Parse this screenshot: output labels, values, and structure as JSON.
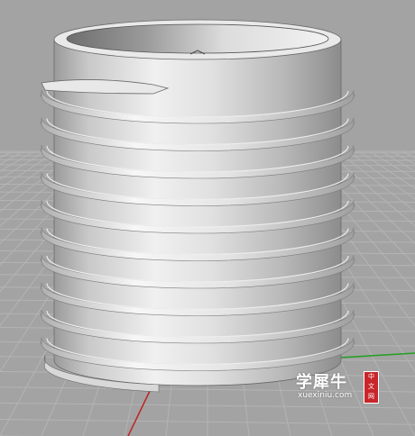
{
  "viewport": {
    "background_color": "#a3a3a3",
    "grid_color": "#b4b4b4",
    "axis_x_color": "#c02424",
    "axis_y_color": "#20a020"
  },
  "model": {
    "shape": "threaded-insert",
    "body_color": "#d4d4d4",
    "highlight_color": "#f4f4f4",
    "shadow_color": "#7a7a7a",
    "thread_turns": 10
  },
  "watermark": {
    "hanzi": "学犀牛",
    "site": "xuexiniu.com",
    "badge_chars": [
      "中",
      "文",
      "网"
    ],
    "badge_color": "#c8262a"
  }
}
